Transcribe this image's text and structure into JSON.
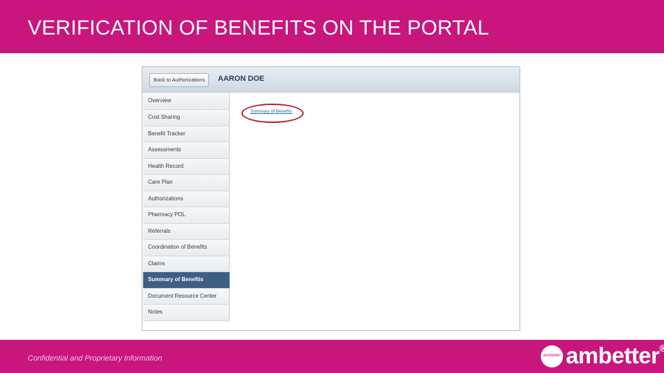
{
  "slide": {
    "title": "VERIFICATION OF BENEFITS ON THE PORTAL",
    "footer_note": "Confidential and Proprietary Information",
    "brand": {
      "word": "ambetter",
      "mark": "®",
      "badge_text": "ambetter"
    }
  },
  "colors": {
    "brand_magenta": "#c8167d",
    "nav_active": "#3d5f86",
    "highlight": "#b01c2e"
  },
  "portal": {
    "back_button": "Back to Authorizations",
    "member_name": "AARON DOE",
    "nav_items": [
      {
        "label": "Overview"
      },
      {
        "label": "Cost Sharing"
      },
      {
        "label": "Benefit Tracker"
      },
      {
        "label": "Assessments"
      },
      {
        "label": "Health Record"
      },
      {
        "label": "Care Plan"
      },
      {
        "label": "Authorizations"
      },
      {
        "label": "Pharmacy PDL"
      },
      {
        "label": "Referrals"
      },
      {
        "label": "Coordination of Benefits"
      },
      {
        "label": "Claims"
      },
      {
        "label": "Summary of Benefits",
        "active": true
      },
      {
        "label": "Document Resource Center"
      },
      {
        "label": "Notes"
      }
    ],
    "content_link": "Summary of Benefits"
  }
}
